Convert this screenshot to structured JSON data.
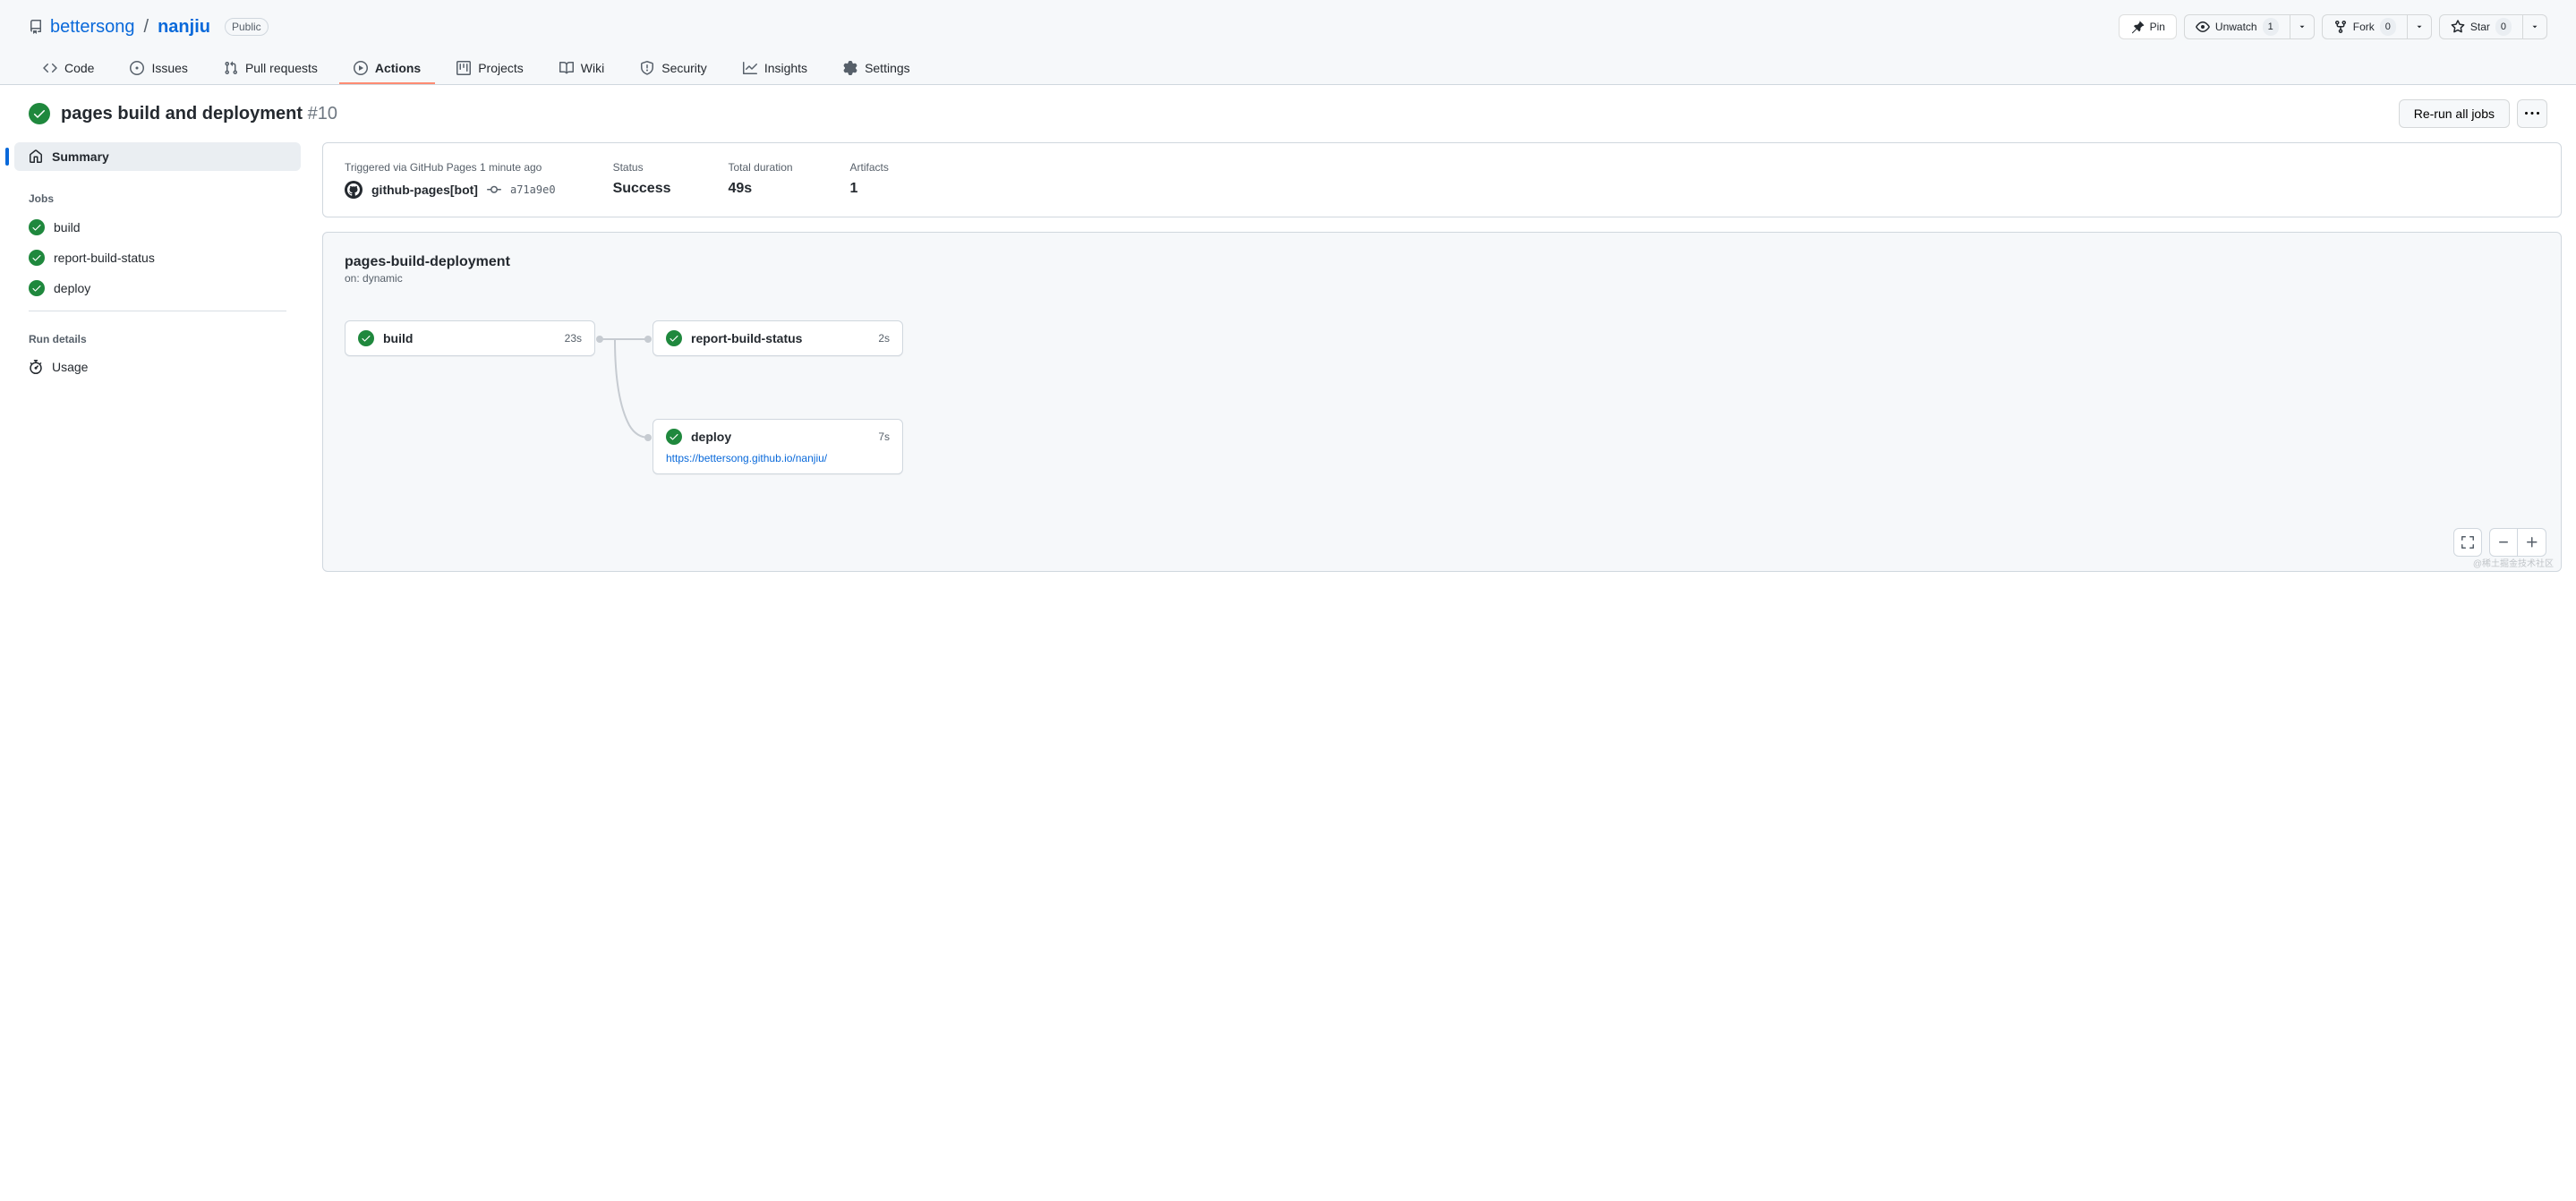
{
  "repo": {
    "owner": "bettersong",
    "name": "nanjiu",
    "visibility": "Public"
  },
  "header_actions": {
    "pin": "Pin",
    "unwatch": "Unwatch",
    "unwatch_count": "1",
    "fork": "Fork",
    "fork_count": "0",
    "star": "Star",
    "star_count": "0"
  },
  "tabs": {
    "code": "Code",
    "issues": "Issues",
    "pulls": "Pull requests",
    "actions": "Actions",
    "projects": "Projects",
    "wiki": "Wiki",
    "security": "Security",
    "insights": "Insights",
    "settings": "Settings"
  },
  "workflow": {
    "title": "pages build and deployment",
    "run_number": "#10",
    "rerun_label": "Re-run all jobs"
  },
  "sidebar": {
    "summary": "Summary",
    "jobs_heading": "Jobs",
    "jobs": [
      "build",
      "report-build-status",
      "deploy"
    ],
    "run_details_heading": "Run details",
    "usage": "Usage"
  },
  "summary": {
    "trigger_text": "Triggered via GitHub Pages 1 minute ago",
    "actor": "github-pages[bot]",
    "commit": "a71a9e0",
    "status_label": "Status",
    "status_value": "Success",
    "duration_label": "Total duration",
    "duration_value": "49s",
    "artifacts_label": "Artifacts",
    "artifacts_value": "1"
  },
  "graph": {
    "title": "pages-build-deployment",
    "subtitle": "on: dynamic",
    "nodes": {
      "build": {
        "name": "build",
        "time": "23s"
      },
      "report": {
        "name": "report-build-status",
        "time": "2s"
      },
      "deploy": {
        "name": "deploy",
        "time": "7s",
        "url": "https://bettersong.github.io/nanjiu/"
      }
    }
  },
  "watermark": "@稀土掘金技术社区"
}
